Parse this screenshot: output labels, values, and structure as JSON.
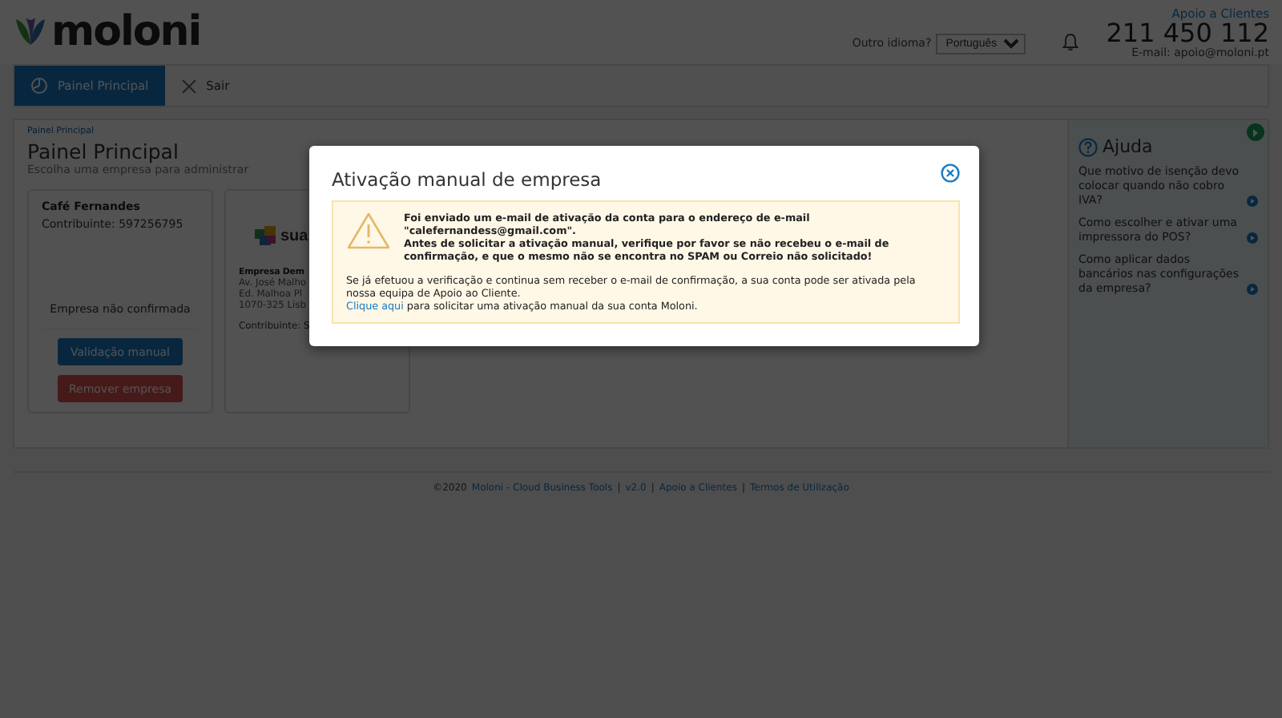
{
  "header": {
    "logo": "moloni",
    "language_label": "Outro idioma?",
    "language": "Português",
    "support_link": "Apoio a Clientes",
    "phone": "211 450 112",
    "email": "E-mail: apoio@moloni.pt"
  },
  "nav": {
    "items": [
      {
        "label": "Painel Principal",
        "kind": "dashboard",
        "selected": true
      },
      {
        "label": "Sair",
        "kind": "exit",
        "selected": false
      }
    ]
  },
  "main": {
    "breadcrumb": "Painel Principal",
    "title": "Painel Principal",
    "subtitle": "Escolha uma empresa para administrar",
    "companies": [
      {
        "kind": "unconfirmed",
        "name": "Café Fernandes",
        "tax_id": "Contribuinte: 597256795",
        "status": "Empresa não confirmada",
        "actions": [
          {
            "label": "Validação manual",
            "kind": "primary"
          },
          {
            "label": "Remover empresa",
            "kind": "danger"
          }
        ]
      },
      {
        "kind": "active",
        "logo_text": "sua",
        "name": "Empresa Dem",
        "address": [
          "Av. José Malho",
          "Ed. Malhoa Pl",
          "1070-325 Lisb"
        ],
        "tax_id": "Contribuinte: S"
      }
    ]
  },
  "help": {
    "title": "Ajuda",
    "items": [
      "Que motivo de isenção devo colocar quando não cobro IVA?",
      "Como escolher e ativar uma impressora do POS?",
      "Como aplicar dados bancários nas configurações da empresa?"
    ]
  },
  "footer": [
    {
      "kind": "text",
      "text": "©2020"
    },
    {
      "kind": "link",
      "text": "Moloni - Cloud Business Tools"
    },
    {
      "kind": "separator",
      "text": "|"
    },
    {
      "kind": "link",
      "text": "v2.0"
    },
    {
      "kind": "separator",
      "text": "|"
    },
    {
      "kind": "link",
      "text": "Apoio a Clientes"
    },
    {
      "kind": "separator",
      "text": "|"
    },
    {
      "kind": "link",
      "text": "Termos de Utilização"
    }
  ],
  "modal": {
    "title": "Ativação manual de empresa",
    "notice": "Foi enviado um e-mail de ativação da conta para o endereço de e-mail \"calefernandess@gmail.com\".",
    "warning": "Antes de solicitar a ativação manual, verifique por favor se não recebeu o e-mail de confirmação, e que o mesmo não se encontra no SPAM ou Correio não solicitado!",
    "info": "Se já efetuou a verificação e continua sem receber o e-mail de confirmação, a sua conta pode ser ativada pela nossa equipa de Apoio ao Cliente.",
    "action_link": "Clique aqui",
    "action_text": "para solicitar uma ativação manual da sua conta Moloni."
  }
}
